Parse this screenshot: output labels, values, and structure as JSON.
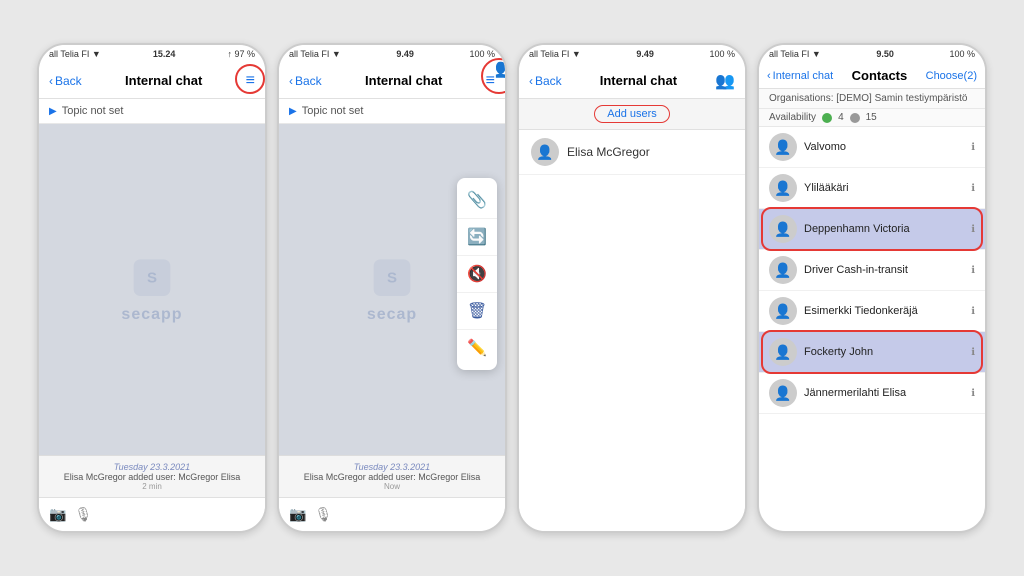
{
  "screens": [
    {
      "id": "screen1",
      "status": {
        "left": "all Telia FI ▼",
        "center": "15.24",
        "right": "↑ 97 %"
      },
      "nav": {
        "back": "Back",
        "title": "Internal chat",
        "icon": "≡"
      },
      "topic": "Topic not set",
      "footer": {
        "date": "Tuesday 23.3.2021",
        "message": "Elisa McGregor added user:\nMcGregor Elisa",
        "time": "2 min"
      },
      "highlight": {
        "type": "icon",
        "label": "hamburger menu circled"
      }
    },
    {
      "id": "screen2",
      "status": {
        "left": "all Telia FI ▼",
        "center": "9.49",
        "right": "100 %"
      },
      "nav": {
        "back": "Back",
        "title": "Internal chat",
        "icon": "≡"
      },
      "topic": "Topic not set",
      "dropdown": [
        {
          "icon": "📎"
        },
        {
          "icon": "🔄"
        },
        {
          "icon": "🔇"
        },
        {
          "icon": "🗑"
        },
        {
          "icon": "✏️"
        }
      ],
      "footer": {
        "date": "Tuesday 23.3.2021",
        "message": "Elisa McGregor added user:\nMcGregor Elisa",
        "time": "Now"
      },
      "highlight": {
        "type": "group-icon",
        "label": "add users circled"
      }
    },
    {
      "id": "screen3",
      "status": {
        "left": "all Telia FI ▼",
        "center": "9.49",
        "right": "100 %"
      },
      "nav": {
        "back": "Back",
        "title": "Internal chat",
        "icon": "👥"
      },
      "add_users_label": "Add users",
      "users": [
        {
          "name": "Elisa McGregor"
        }
      ]
    },
    {
      "id": "screen4",
      "status": {
        "left": "all Telia FI ▼",
        "center": "9.50",
        "right": "100 %"
      },
      "nav": {
        "back": "Internal chat",
        "title": "Contacts",
        "choose": "Choose(2)"
      },
      "organisation": "[DEMO] Samin testiympäristö",
      "availability": {
        "green": 4,
        "grey": 15
      },
      "contacts": [
        {
          "name": "Valvomo",
          "selected": false
        },
        {
          "name": "Ylilääkäri",
          "selected": false
        },
        {
          "name": "Deppenhamn Victoria",
          "selected": true
        },
        {
          "name": "Driver Cash-in-transit",
          "selected": false
        },
        {
          "name": "Esimerkki Tiedonkeräjä",
          "selected": false
        },
        {
          "name": "Fockerty John",
          "selected": true
        },
        {
          "name": "Jännermerilahti Elisa",
          "selected": false
        }
      ]
    }
  ]
}
